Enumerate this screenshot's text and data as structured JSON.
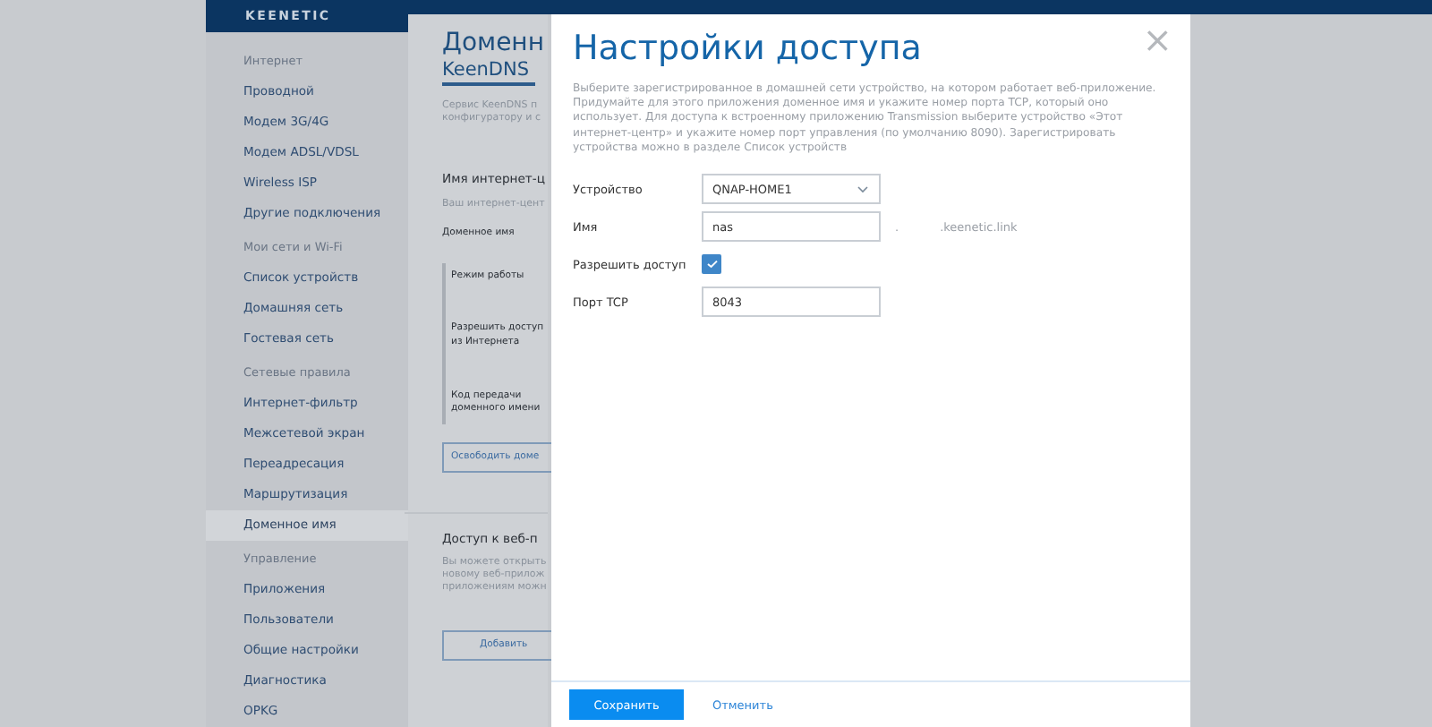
{
  "logo": "KEENETIC",
  "sidebar": {
    "groups": [
      {
        "title": "Интернет",
        "items": [
          {
            "label": "Проводной",
            "selected": false
          },
          {
            "label": "Модем 3G/4G",
            "selected": false
          },
          {
            "label": "Модем ADSL/VDSL",
            "selected": false
          },
          {
            "label": "Wireless ISP",
            "selected": false
          },
          {
            "label": "Другие подключения",
            "selected": false
          }
        ]
      },
      {
        "title": "Мои сети и Wi-Fi",
        "items": [
          {
            "label": "Список устройств",
            "selected": false
          },
          {
            "label": "Домашняя сеть",
            "selected": false
          },
          {
            "label": "Гостевая сеть",
            "selected": false
          }
        ]
      },
      {
        "title": "Сетевые правила",
        "items": [
          {
            "label": "Интернет-фильтр",
            "selected": false
          },
          {
            "label": "Межсетевой экран",
            "selected": false
          },
          {
            "label": "Переадресация",
            "selected": false
          },
          {
            "label": "Маршрутизация",
            "selected": false
          },
          {
            "label": "Доменное имя",
            "selected": true
          }
        ]
      },
      {
        "title": "Управление",
        "items": [
          {
            "label": "Приложения",
            "selected": false
          },
          {
            "label": "Пользователи",
            "selected": false
          },
          {
            "label": "Общие настройки",
            "selected": false
          },
          {
            "label": "Диагностика",
            "selected": false
          },
          {
            "label": "OPKG",
            "selected": false
          }
        ]
      }
    ]
  },
  "page": {
    "title": "Доменн",
    "tab": "KeenDNS",
    "intro": [
      "Сервис KeenDNS п",
      "конфигуратору и с"
    ],
    "section1": {
      "title": "Имя интернет-ц",
      "hint": "Ваш интернет-цент",
      "field_label": "Доменное имя",
      "rows": [
        "Режим работы",
        "Разрешить доступ из Интернета",
        "Код передачи доменного имени"
      ],
      "button": "Освободить доме"
    },
    "section2": {
      "title": "Доступ к веб-п",
      "hint": [
        "Вы можете открыть",
        "новому веб-прилож",
        "приложениям можн"
      ],
      "button": "Добавить"
    }
  },
  "dialog": {
    "title": "Настройки доступа",
    "close": "×",
    "description": "Выберите зарегистрированное в домашней сети устройство, на котором работает веб-приложение. Придумайте для этого приложения доменное имя и укажите номер порта TCP, который оно использует. Для доступа к встроенному приложению Transmission выберите устройство «Этот интернет-центр» и укажите номер порт управления (по умолчанию 8090). Зарегистрировать устройства можно в разделе Список устройств",
    "fields": [
      {
        "kind": "select",
        "label": "Устройство",
        "value": "QNAP-HOME1"
      },
      {
        "kind": "text",
        "label": "Имя",
        "value": "nas",
        "suffix_dot": ".",
        "suffix": ".keenetic.link"
      },
      {
        "kind": "checkbox",
        "label": "Разрешить доступ",
        "checked": true
      },
      {
        "kind": "text",
        "label": "Порт TCP",
        "value": "8043"
      }
    ],
    "buttons": {
      "save": "Сохранить",
      "cancel": "Отменить"
    }
  }
}
